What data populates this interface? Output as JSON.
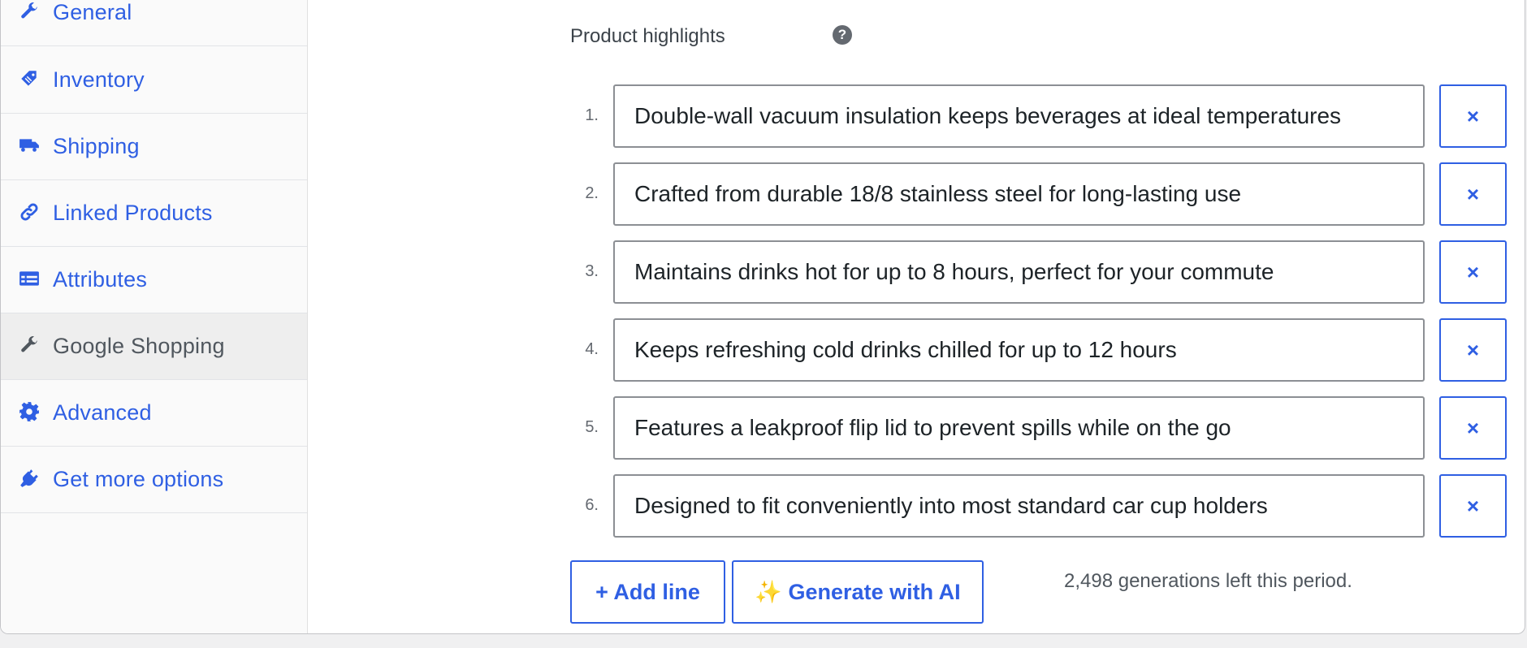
{
  "sidebar": {
    "items": [
      {
        "label": "General",
        "icon": "wrench-icon",
        "active": false
      },
      {
        "label": "Inventory",
        "icon": "tag-icon",
        "active": false
      },
      {
        "label": "Shipping",
        "icon": "truck-icon",
        "active": false
      },
      {
        "label": "Linked Products",
        "icon": "link-icon",
        "active": false
      },
      {
        "label": "Attributes",
        "icon": "list-card-icon",
        "active": false
      },
      {
        "label": "Google Shopping",
        "icon": "wrench-icon",
        "active": true
      },
      {
        "label": "Advanced",
        "icon": "gear-icon",
        "active": false
      },
      {
        "label": "Get more options",
        "icon": "plug-icon",
        "active": false
      }
    ]
  },
  "highlights": {
    "label": "Product highlights",
    "help_icon": "?",
    "remove_symbol": "×",
    "lines": [
      {
        "num": "1.",
        "value": "Double-wall vacuum insulation keeps beverages at ideal temperatures"
      },
      {
        "num": "2.",
        "value": "Crafted from durable 18/8 stainless steel for long-lasting use"
      },
      {
        "num": "3.",
        "value": "Maintains drinks hot for up to 8 hours, perfect for your commute"
      },
      {
        "num": "4.",
        "value": "Keeps refreshing cold drinks chilled for up to 12 hours"
      },
      {
        "num": "5.",
        "value": "Features a leakproof flip lid to prevent spills while on the go"
      },
      {
        "num": "6.",
        "value": "Designed to fit conveniently into most standard car cup holders"
      }
    ],
    "add_line_label": "+ Add line",
    "generate_label": "✨ Generate with AI",
    "quota_text": "2,498 generations left this period."
  },
  "colors": {
    "accent": "#2f5fe3",
    "active_tab_bg": "#eeeeee",
    "border": "#8c8f94"
  }
}
